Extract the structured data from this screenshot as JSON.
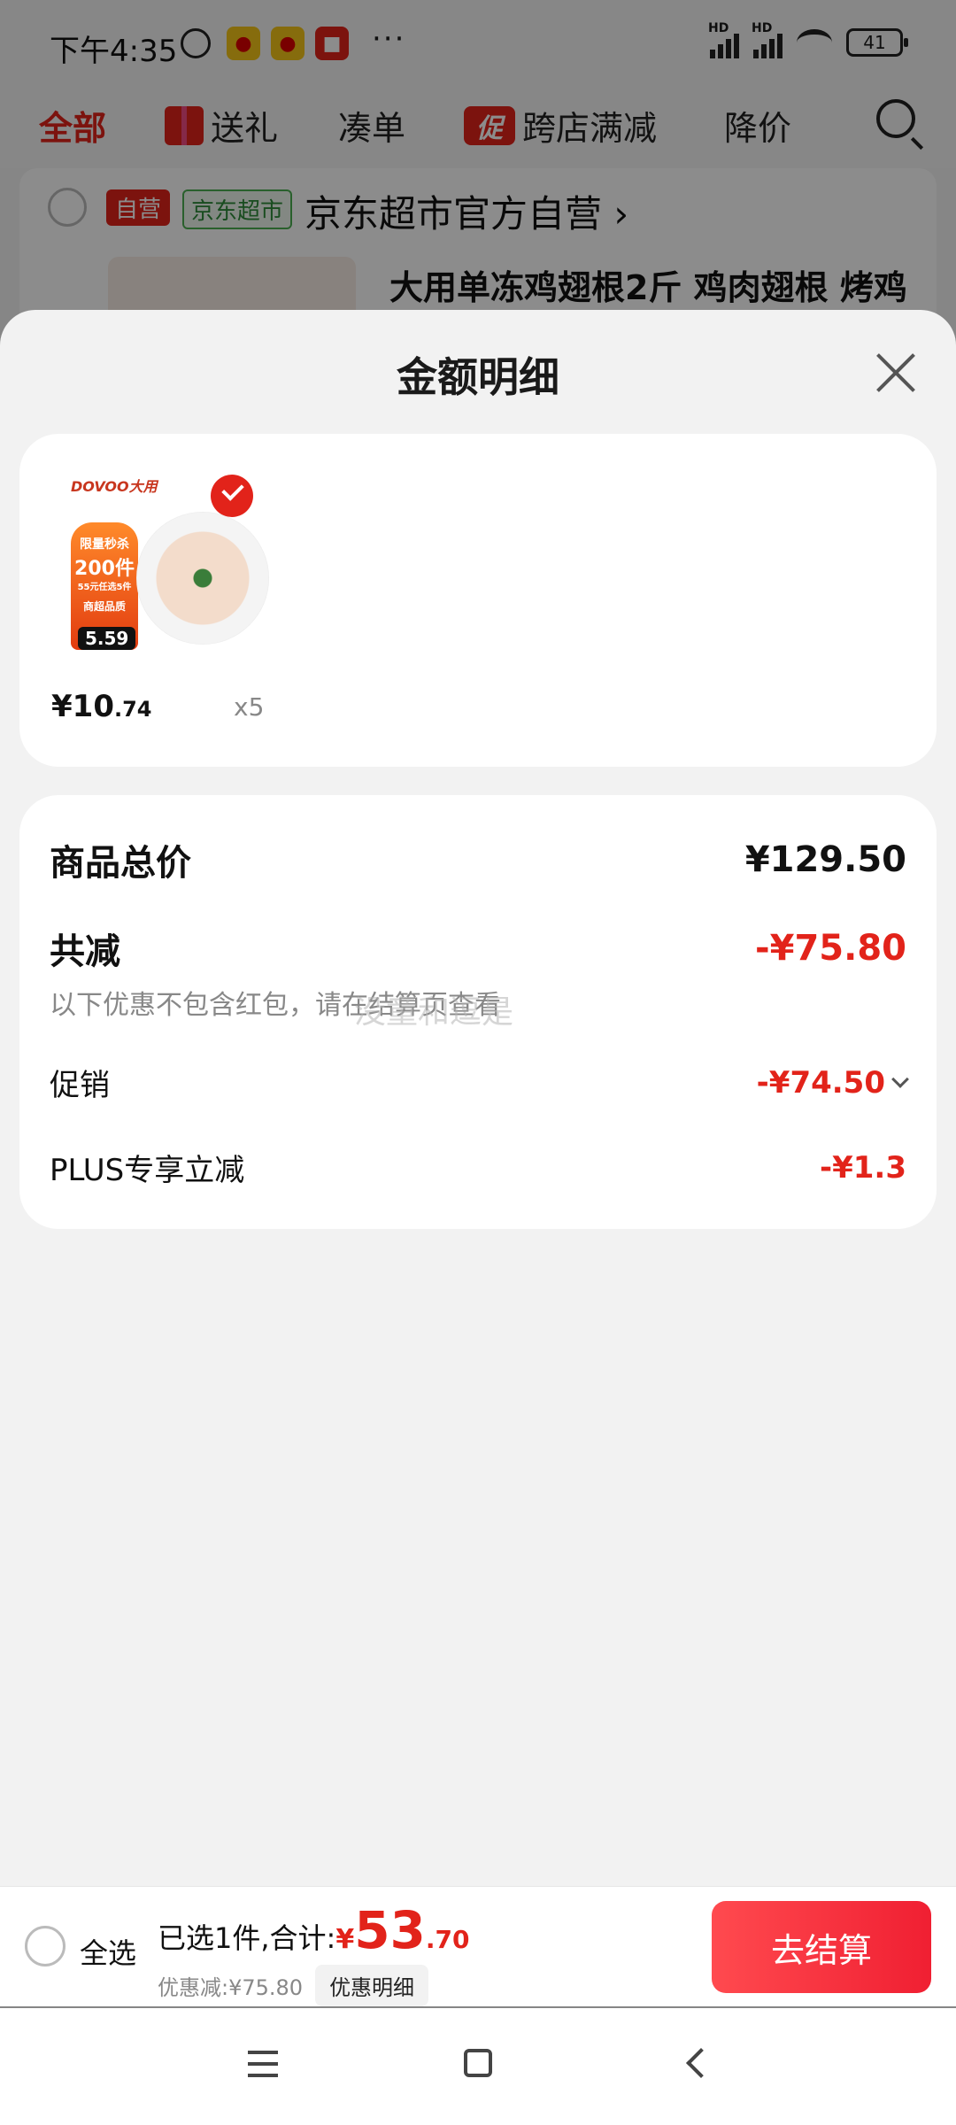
{
  "status_bar": {
    "time": "下午4:35",
    "dots": "···",
    "battery": "41",
    "hd1": "HD",
    "hd2": "HD"
  },
  "tabs": [
    {
      "label": "全部"
    },
    {
      "label": "送礼"
    },
    {
      "label": "凑单"
    },
    {
      "label": "促",
      "label2": "跨店满减"
    },
    {
      "label": "降价"
    }
  ],
  "store": {
    "tag_self": "自营",
    "tag_market": "京东超市",
    "name": "京东超市官方自营 ›",
    "product_title": "大用单冻鸡翅根2斤 鸡肉翅根 烤鸡"
  },
  "sheet": {
    "title": "金额明细",
    "item": {
      "brand": "DOVOO大用",
      "flame_line1": "限量秒杀",
      "flame_line2": "200件",
      "flame_line3": "55元任选5件",
      "flame_line4": "商超品质",
      "tag_price": "5.59",
      "price_int": "¥10",
      "price_dec": ".74",
      "qty": "x5"
    },
    "summary": {
      "total_label": "商品总价",
      "total_value": "¥129.50",
      "reduce_label": "共减",
      "reduce_value": "-¥75.80",
      "note": "以下优惠不包含红包，请在结算页查看",
      "promo_label": "促销",
      "promo_value": "-¥74.50",
      "plus_label": "PLUS专享立减",
      "plus_value": "-¥1.3"
    },
    "watermark": "没童和逗是"
  },
  "checkout": {
    "select_all": "全选",
    "selected_text": "已选1件,合计:",
    "yen": "¥",
    "total_int": "53",
    "total_dec": ".70",
    "discount_text": "优惠减:¥75.80",
    "detail_btn": "优惠明细",
    "checkout_btn": "去结算"
  },
  "colors": {
    "accent": "#e2231a",
    "market_green": "#2e8b3a"
  },
  "icons": [
    "alarm-icon",
    "weibo-icon",
    "weibo-icon",
    "app-icon",
    "signal-icon",
    "wifi-icon",
    "battery-icon",
    "gift-icon",
    "search-icon",
    "close-icon",
    "check-icon",
    "chevron-down-icon",
    "menu-icon",
    "home-icon",
    "back-icon"
  ]
}
